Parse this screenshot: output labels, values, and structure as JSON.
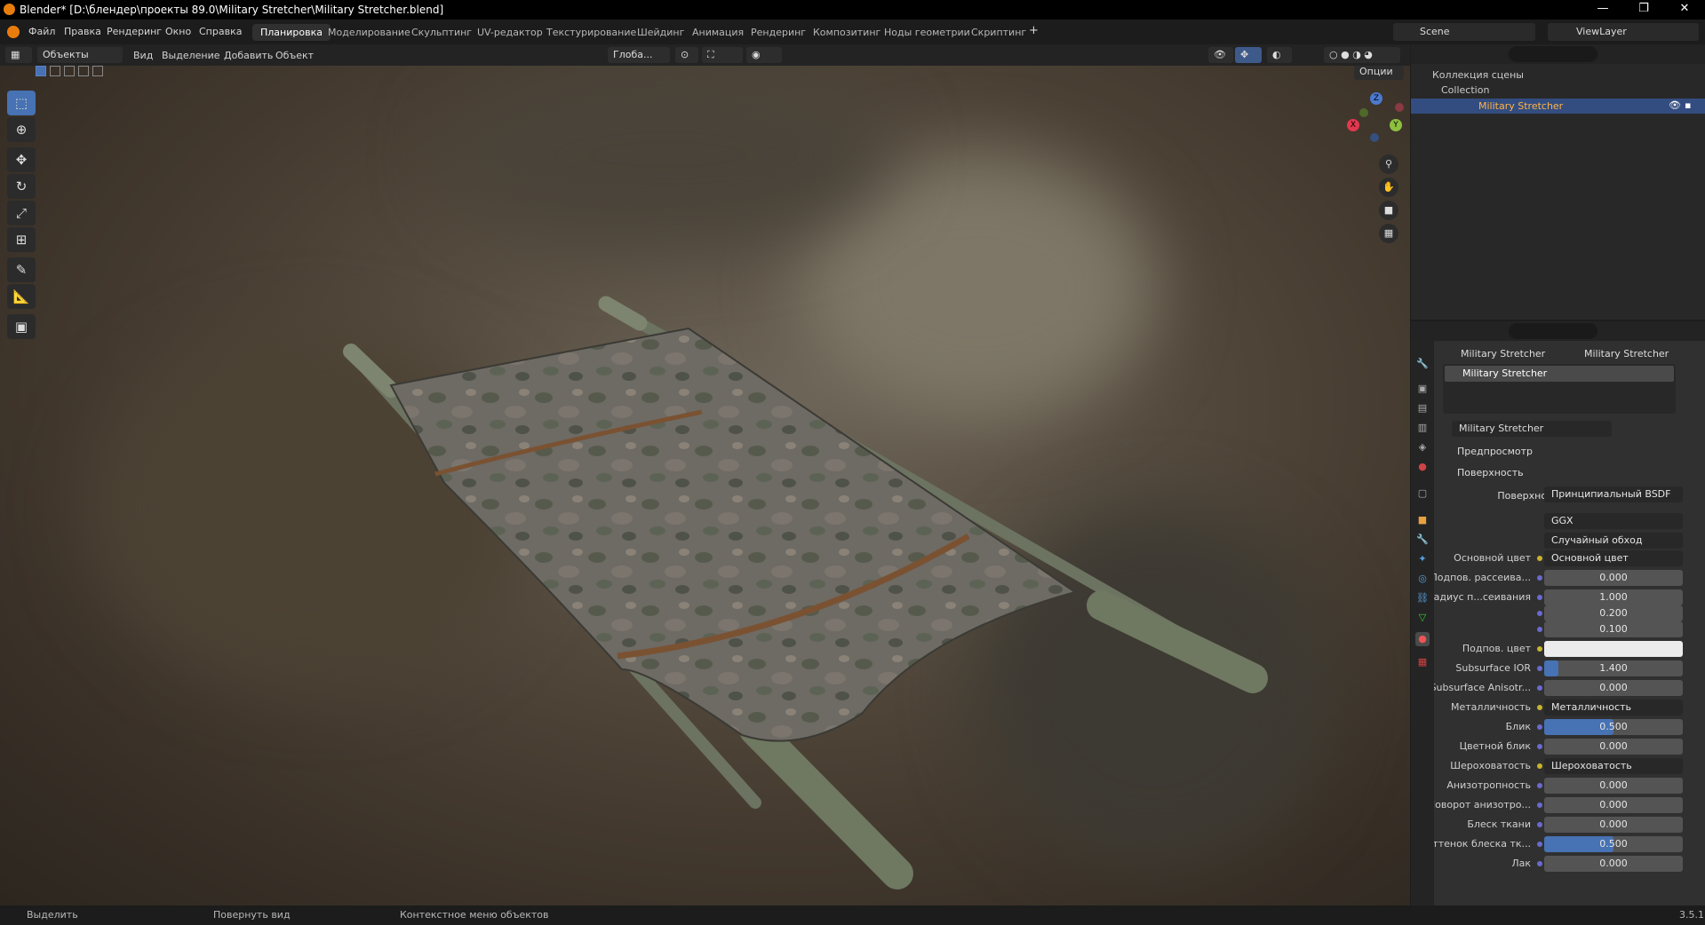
{
  "window": {
    "title": "Blender* [D:\\блендер\\проекты 89.0\\Military Stretcher\\Military Stretcher.blend]",
    "min": "—",
    "max": "❐",
    "close": "✕"
  },
  "menu": {
    "items": [
      "Файл",
      "Правка",
      "Рендеринг",
      "Окно",
      "Справка"
    ],
    "workspaces": [
      "Планировка",
      "Моделирование",
      "Скульптинг",
      "UV-редактор",
      "Текстурирование",
      "Шейдинг",
      "Анимация",
      "Рендеринг",
      "Композитинг",
      "Ноды геометрии",
      "Скриптинг"
    ],
    "active_workspace": "Планировка",
    "add": "+",
    "scene": "Scene",
    "view_layer": "ViewLayer"
  },
  "viewport_header": {
    "mode": "Объекты",
    "items": [
      "Вид",
      "Выделение",
      "Добавить",
      "Объект"
    ],
    "transform": "Глоба...",
    "options": "Опции"
  },
  "gizmo": {
    "z": "Z",
    "y": "Y",
    "x": "X"
  },
  "outliner": {
    "scene_collection": "Коллекция сцены",
    "collection": "Collection",
    "object": "Military Stretcher"
  },
  "properties": {
    "breadcrumb_object": "Military Stretcher",
    "breadcrumb_material": "Military Stretcher",
    "slot": "Military Stretcher",
    "material_name": "Military Stretcher",
    "preview": "Предпросмотр",
    "surface_section": "Поверхность",
    "surface_label": "Поверхность",
    "surface_value": "Принципиальный BSDF",
    "distribution": "GGX",
    "subsurface_method": "Случайный обход",
    "rows": [
      {
        "label": "Основной цвет",
        "value": "Основной цвет",
        "type": "link",
        "expand": true
      },
      {
        "label": "Подпов. рассеива...",
        "value": "0.000",
        "type": "num"
      },
      {
        "label": "Радиус п...сеивания",
        "value": "1.000",
        "type": "num"
      },
      {
        "label": "",
        "value": "0.200",
        "type": "num"
      },
      {
        "label": "",
        "value": "0.100",
        "type": "num"
      },
      {
        "label": "Подпов. цвет",
        "value": "",
        "type": "color"
      },
      {
        "label": "Subsurface IOR",
        "value": "1.400",
        "type": "num",
        "fill": 0.1
      },
      {
        "label": "Subsurface Anisotr...",
        "value": "0.000",
        "type": "num"
      },
      {
        "label": "Металличность",
        "value": "Металличность",
        "type": "link",
        "expand": true
      },
      {
        "label": "Блик",
        "value": "0.500",
        "type": "num",
        "fill": 0.5
      },
      {
        "label": "Цветной блик",
        "value": "0.000",
        "type": "num"
      },
      {
        "label": "Шероховатость",
        "value": "Шероховатость",
        "type": "link",
        "expand": true
      },
      {
        "label": "Анизотропность",
        "value": "0.000",
        "type": "num"
      },
      {
        "label": "Поворот анизотро...",
        "value": "0.000",
        "type": "num"
      },
      {
        "label": "Блеск ткани",
        "value": "0.000",
        "type": "num"
      },
      {
        "label": "Оттенок блеска тк...",
        "value": "0.500",
        "type": "num",
        "fill": 0.5
      },
      {
        "label": "Лак",
        "value": "0.000",
        "type": "num"
      }
    ]
  },
  "status": {
    "select": "Выделить",
    "rotate": "Повернуть вид",
    "context": "Контекстное меню объектов",
    "version": "3.5.1"
  }
}
